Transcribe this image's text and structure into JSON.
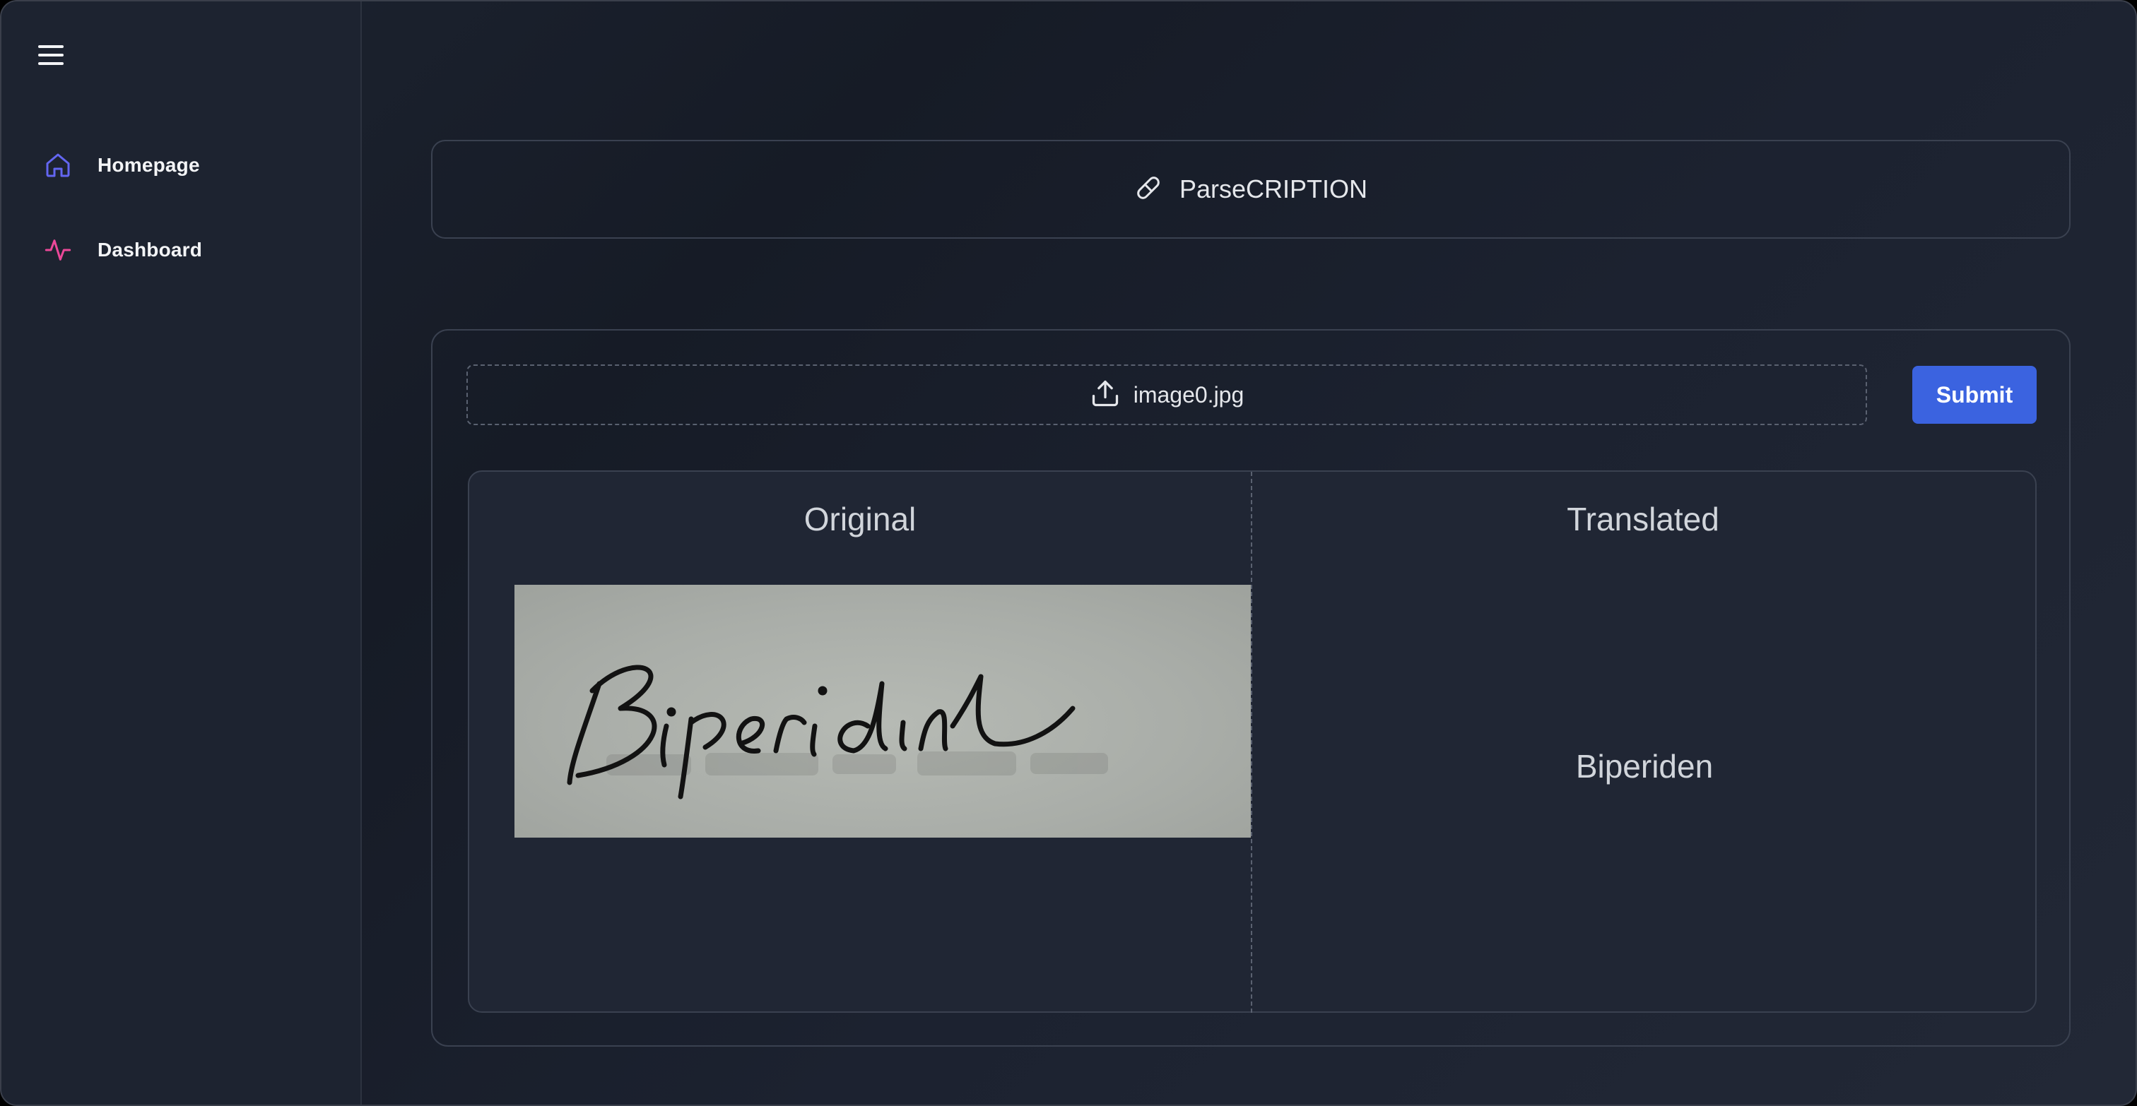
{
  "sidebar": {
    "menu_icon": "hamburger-menu-icon",
    "items": [
      {
        "label": "Homepage",
        "icon": "home-icon",
        "color": "#6366f1"
      },
      {
        "label": "Dashboard",
        "icon": "activity-pulse-icon",
        "color": "#ec4899"
      }
    ]
  },
  "header": {
    "icon": "pill-icon",
    "title": "ParseCRIPTION"
  },
  "upload": {
    "icon": "upload-icon",
    "filename": "image0.jpg"
  },
  "submit": {
    "label": "Submit",
    "color": "#3b63e0"
  },
  "comparison": {
    "original": {
      "heading": "Original",
      "image_handwriting": "Biperidine"
    },
    "translated": {
      "heading": "Translated",
      "text": "Biperiden"
    }
  }
}
